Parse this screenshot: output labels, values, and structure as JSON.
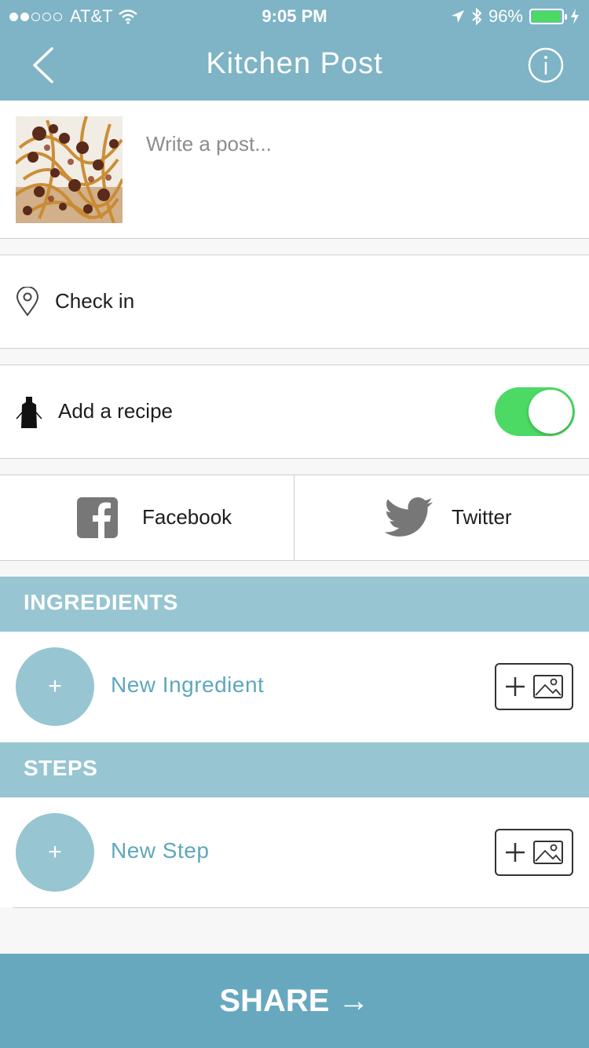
{
  "status_bar": {
    "carrier": "AT&T",
    "time": "9:05 PM",
    "battery": "96%",
    "signal_dots_filled": 2,
    "signal_dots_total": 5
  },
  "nav": {
    "title": "Kitchen Post",
    "back_icon": "chevron-left-icon",
    "info_icon": "info-icon"
  },
  "post": {
    "placeholder": "Write a post..."
  },
  "check_in": {
    "label": "Check in",
    "icon": "location-pin-icon"
  },
  "recipe": {
    "label": "Add a recipe",
    "icon": "apron-icon",
    "toggle_on": true
  },
  "social": {
    "facebook": "Facebook",
    "twitter": "Twitter"
  },
  "ingredients": {
    "header": "INGREDIENTS",
    "add_symbol": "+",
    "new_label": "New Ingredient"
  },
  "steps": {
    "header": "STEPS",
    "add_symbol": "+",
    "new_label": "New Step"
  },
  "share": {
    "label": "SHARE →"
  },
  "colors": {
    "nav_bar": "#7eb4c5",
    "section_header": "#97c5d2",
    "accent_text": "#5ea7bd",
    "share_bar": "#67a8bf",
    "toggle_on": "#4cd964"
  }
}
